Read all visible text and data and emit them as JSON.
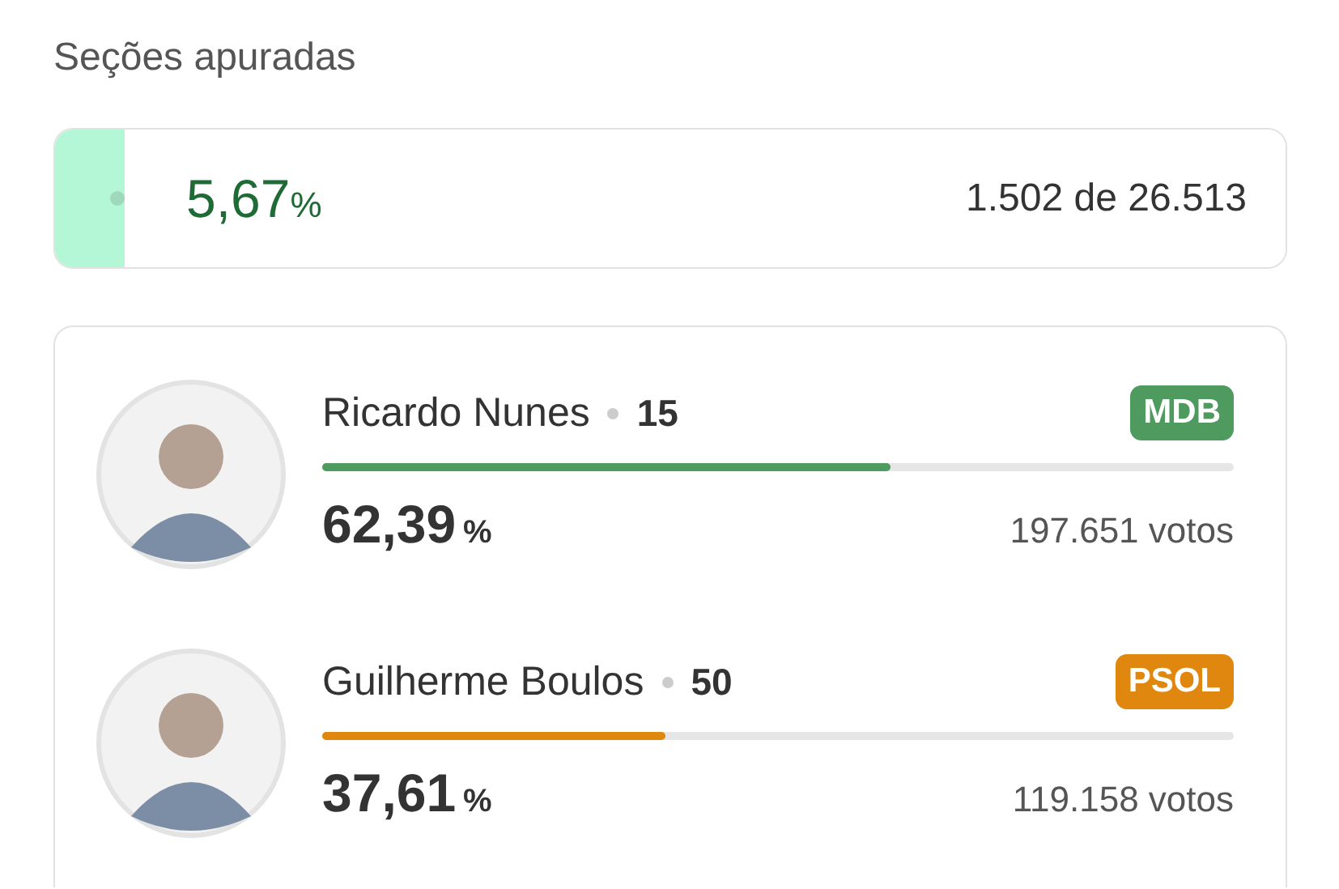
{
  "sections": {
    "title": "Seções apuradas",
    "level": 0.0567,
    "percent": "5,67",
    "percent_sign": "%",
    "count": "1.502 de 26.513"
  },
  "candidates": [
    {
      "name": "Ricardo Nunes",
      "number": "15",
      "party": "MDB",
      "color": "#4f9a5f",
      "level": 0.6239,
      "percent": "62,39",
      "percent_sign": "%",
      "votes": "197.651 votos"
    },
    {
      "name": "Guilherme Boulos",
      "number": "50",
      "party": "PSOL",
      "color": "#e0870f",
      "level": 0.3761,
      "percent": "37,61",
      "percent_sign": "%",
      "votes": "119.158 votos"
    }
  ]
}
